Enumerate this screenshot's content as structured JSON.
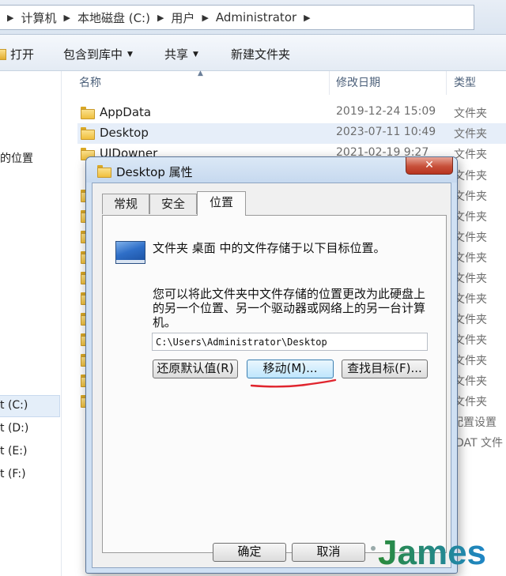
{
  "explorer": {
    "breadcrumb": [
      "计算机",
      "本地磁盘 (C:)",
      "用户",
      "Administrator"
    ],
    "toolbar": {
      "open": "打开",
      "include_in_library": "包含到库中",
      "share": "共享",
      "new_folder": "新建文件夹"
    },
    "nav": {
      "location_fragment": "的位置",
      "drives": [
        "t (C:)",
        "t (D:)",
        "t (E:)",
        "t (F:)"
      ]
    },
    "columns": {
      "name": "名称",
      "date": "修改日期",
      "type": "类型"
    },
    "files": [
      {
        "name": "AppData",
        "date": "2019-12-24 15:09",
        "type": "文件夹"
      },
      {
        "name": "Desktop",
        "date": "2023-07-11 10:49",
        "type": "文件夹"
      },
      {
        "name": "UIDowner",
        "date": "2021-02-19 9:27",
        "type": "文件夹"
      }
    ],
    "type_column_rest": [
      "文件夹",
      "文件夹",
      "文件夹",
      "文件夹",
      "文件夹",
      "文件夹",
      "文件夹",
      "文件夹",
      "文件夹",
      "文件夹",
      "文件夹",
      "文件夹",
      "配置设置",
      "DAT 文件"
    ]
  },
  "dialog": {
    "title": "Desktop 属性",
    "close": "✕",
    "tabs": [
      "常规",
      "安全",
      "位置"
    ],
    "active_tab": "位置",
    "line1": "文件夹 桌面 中的文件存储于以下目标位置。",
    "line2a": "您可以将此文件夹中文件存储的位置更改为此硬盘上",
    "line2b": "的另一个位置、另一个驱动器或网络上的另一台计算",
    "line2c": "机。",
    "path": "C:\\Users\\Administrator\\Desktop",
    "restore_btn": "还原默认值(R)",
    "move_btn": "移动(M)...",
    "find_btn": "查找目标(F)...",
    "ok_btn": "确定",
    "cancel_btn": "取消"
  },
  "watermark": {
    "text": "James",
    "colors": [
      "#2a8a3a",
      "#1f86c8"
    ]
  }
}
